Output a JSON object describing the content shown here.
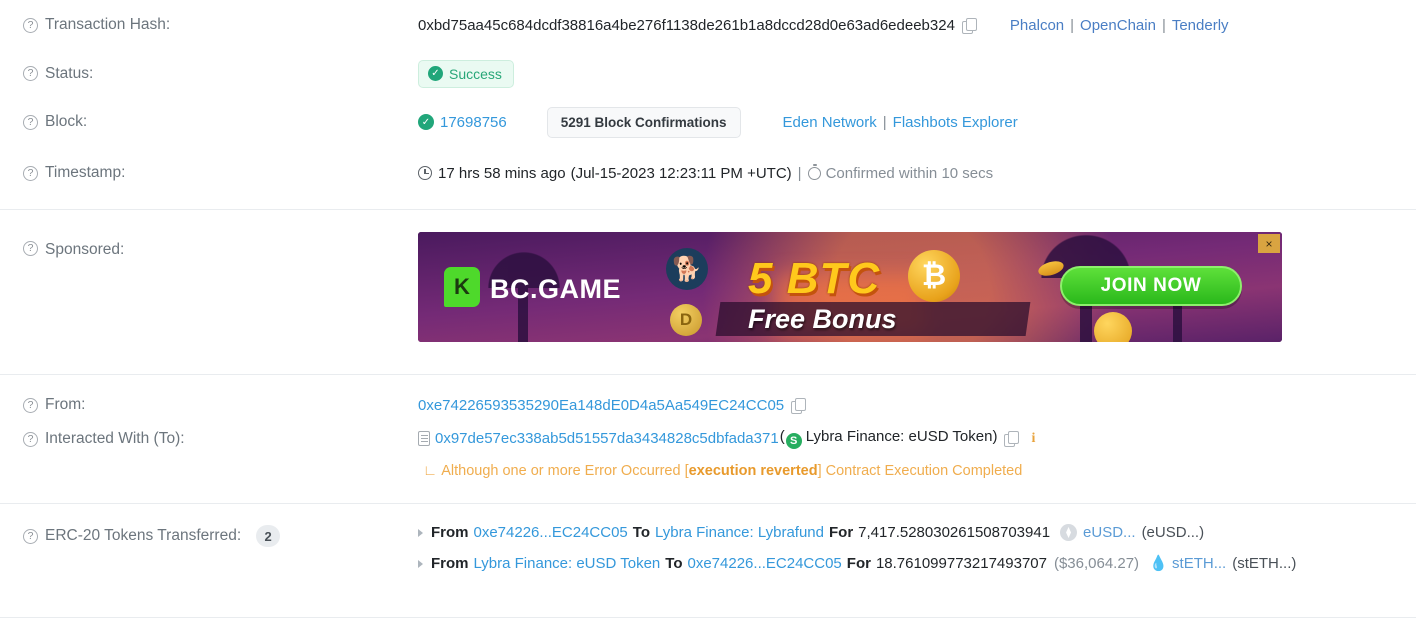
{
  "rows": {
    "tx_hash": {
      "label": "Transaction Hash:",
      "value": "0xbd75aa45c684dcdf38816a4be276f1138de261b1a8dccd28d0e63ad6edeeb324",
      "links": [
        "Phalcon",
        "OpenChain",
        "Tenderly"
      ]
    },
    "status": {
      "label": "Status:",
      "value": "Success"
    },
    "block": {
      "label": "Block:",
      "number": "17698756",
      "confirmations": "5291 Block Confirmations",
      "links": [
        "Eden Network",
        "Flashbots Explorer"
      ]
    },
    "timestamp": {
      "label": "Timestamp:",
      "ago": "17 hrs 58 mins ago",
      "absolute": "(Jul-15-2023 12:23:11 PM +UTC)",
      "confirmed_within": "Confirmed within 10 secs"
    },
    "sponsored": {
      "label": "Sponsored:",
      "brand": "BC.GAME",
      "brand_mark": "K",
      "headline": "5 BTC",
      "subline": "Free Bonus",
      "cta": "JOIN NOW",
      "close_label": "×",
      "shib_glyph": "🐕",
      "doge_glyph": "D",
      "btc_glyph": "₿"
    },
    "from": {
      "label": "From:",
      "address": "0xe74226593535290Ea148dE0D4a5Aa549EC24CC05"
    },
    "to": {
      "label": "Interacted With (To):",
      "address": "0x97de57ec338ab5d51557da3434828c5dbfada371",
      "contract_name": "(Lybra Finance: eUSD Token)",
      "token_mark": "S",
      "warning_prefix": "Although one or more Error Occurred [",
      "warning_strong": "execution reverted",
      "warning_suffix": "] Contract Execution Completed"
    },
    "erc20": {
      "label": "ERC-20 Tokens Transferred:",
      "count": "2",
      "transfers": [
        {
          "from_kw": "From",
          "from": "0xe74226...EC24CC05",
          "to_kw": "To",
          "to": "Lybra Finance: Lybrafund",
          "for_kw": "For",
          "amount": "7,417.528030261508703941",
          "usd": "",
          "token_name": "eUSD...",
          "token_symbol": "(eUSD...)",
          "token_icon": "eusd-token-icon"
        },
        {
          "from_kw": "From",
          "from": "Lybra Finance: eUSD Token",
          "to_kw": "To",
          "to": "0xe74226...EC24CC05",
          "for_kw": "For",
          "amount": "18.761099773217493707",
          "usd": "($36,064.27)",
          "token_name": "stETH...",
          "token_symbol": "(stETH...)",
          "token_icon": "steth-token-icon"
        }
      ]
    }
  },
  "icons": {
    "help": "?",
    "check": "✓",
    "copy": "copy-icon",
    "info": "i",
    "corner": "∟",
    "steth_glyph": "💧"
  },
  "colors": {
    "link": "#3498db",
    "link_blue": "#4a7ec4",
    "success": "#21a67a",
    "warning": "#f0ad4e",
    "label": "#6c757d"
  }
}
